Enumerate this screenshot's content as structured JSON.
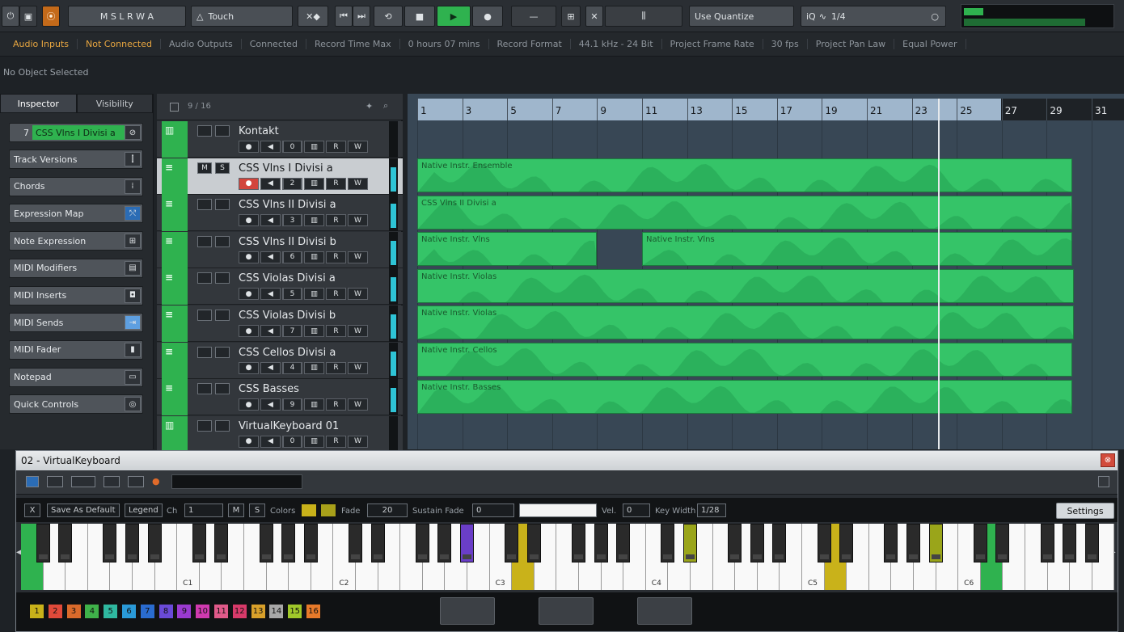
{
  "transport": {
    "mode_touch": "Touch",
    "use_quantize": "Use Quantize",
    "quantize_value": "1/4",
    "quantize_prefix": "iQ",
    "icons": [
      "mixer-icon",
      "record-mode-icon",
      "loop-icon",
      "stop-icon",
      "play-icon",
      "record-icon",
      "rewind-icon",
      "forward-icon",
      "snap-icon"
    ]
  },
  "statusbar": {
    "audio_inputs_label": "Audio Inputs",
    "audio_inputs_value": "Not Connected",
    "audio_outputs_label": "Audio Outputs",
    "audio_outputs_value": "Connected",
    "record_time_label": "Record Time Max",
    "record_time_value": "0 hours 07 mins",
    "record_format_label": "Record Format",
    "record_format_value": "44.1 kHz - 24 Bit",
    "frame_rate_label": "Project Frame Rate",
    "frame_rate_value": "30 fps",
    "pan_law_label": "Project Pan Law",
    "pan_law_value": "Equal Power"
  },
  "info_line": "No Object Selected",
  "inspector": {
    "tabs": [
      "Inspector",
      "Visibility"
    ],
    "track_name": "CSS Vlns I Divisi a",
    "track_number": "7",
    "sections": [
      "Track Versions",
      "Chords",
      "Expression Map",
      "Note Expression",
      "MIDI Modifiers",
      "MIDI Inserts",
      "MIDI Sends",
      "MIDI Fader",
      "Notepad",
      "Quick Controls"
    ]
  },
  "tracklist": {
    "count": "9 / 16",
    "tracks": [
      {
        "name": "Kontakt",
        "num": "0"
      },
      {
        "name": "CSS Vlns I Divisi a",
        "num": "2"
      },
      {
        "name": "CSS Vlns II Divisi a",
        "num": "3"
      },
      {
        "name": "CSS Vlns II Divisi b",
        "num": "6"
      },
      {
        "name": "CSS Violas Divisi a",
        "num": "5"
      },
      {
        "name": "CSS Violas Divisi b",
        "num": "7"
      },
      {
        "name": "CSS Cellos Divisi a",
        "num": "4"
      },
      {
        "name": "CSS Basses",
        "num": "9"
      },
      {
        "name": "VirtualKeyboard 01",
        "num": "0"
      }
    ]
  },
  "ruler": {
    "bars": [
      "1",
      "3",
      "5",
      "7",
      "9",
      "11",
      "13",
      "15",
      "17",
      "19",
      "21",
      "23",
      "25",
      "27",
      "29",
      "31"
    ]
  },
  "parts": [
    {
      "name": "Native Instr. Ensemble"
    },
    {
      "name": "CSS Vlns II Divisi a"
    },
    {
      "name": "Native Instr. Vlns"
    },
    {
      "name": "Native Instr. Vlns"
    },
    {
      "name": "Native Instr. Violas"
    },
    {
      "name": "Native Instr. Violas"
    },
    {
      "name": "Native Instr. Cellos"
    },
    {
      "name": "Native Instr. Basses"
    }
  ],
  "vk": {
    "title": "02 - VirtualKeyboard",
    "close": "⊗",
    "x_label": "X",
    "save_default": "Save As Default",
    "legend": "Legend",
    "ch_label": "Ch",
    "ch_value": "1",
    "m_label": "M",
    "s_label": "S",
    "colors_label": "Colors",
    "fade_label": "Fade",
    "fade_value": "20",
    "sustain_label": "Sustain Fade",
    "sustain_value": "0",
    "vel_label": "Vel.",
    "vel_value": "0",
    "keywidth_label": "Key Width",
    "keywidth_value": "1/28",
    "settings": "Settings",
    "octave_labels": [
      "C1",
      "C2",
      "C3",
      "C4",
      "C5",
      "C6"
    ],
    "channels": [
      "1",
      "2",
      "3",
      "4",
      "5",
      "6",
      "7",
      "8",
      "9",
      "10",
      "11",
      "12",
      "13",
      "14",
      "15",
      "16"
    ],
    "channel_colors": [
      "#c9b21a",
      "#e04a3a",
      "#d96a2b",
      "#3fb24a",
      "#2fb8a0",
      "#2a9ad8",
      "#2a6cd0",
      "#6a4ad8",
      "#9a3ad0",
      "#d03ab0",
      "#e05a8a",
      "#d83a6a",
      "#d8a02a",
      "#a8a8a8",
      "#a0c82a",
      "#e87a2a"
    ],
    "highlight_colors": {
      "green": "#2fb24f",
      "purple": "#6a3ec8",
      "yellow": "#c9b21a",
      "olive": "#9aa51a"
    }
  }
}
